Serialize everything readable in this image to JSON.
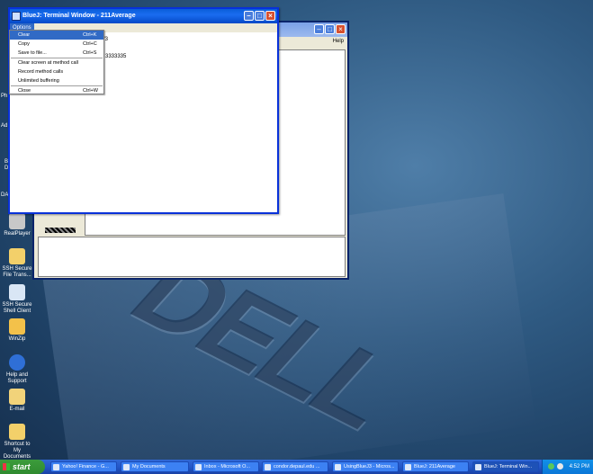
{
  "desktop": {
    "icons": [
      {
        "label": "RealPlayer",
        "color": "#c8c8c8"
      },
      {
        "label": "SSH Secure File Trans...",
        "color": "#f3d06a"
      },
      {
        "label": "SSH Secure Shell Client",
        "color": "#d9e6f5"
      },
      {
        "label": "WinZip",
        "color": "#f3c14a"
      },
      {
        "label": "Help and Support",
        "color": "#2f6fd6"
      },
      {
        "label": "E-mail",
        "color": "#f2d37a"
      },
      {
        "label": "Shortcut to My Documents",
        "color": "#f3d06a"
      }
    ],
    "partial_labels": [
      "Ph",
      "Ad",
      "B",
      "D",
      "DA"
    ]
  },
  "back_window": {
    "help_label": "Help"
  },
  "terminal_window": {
    "title": "BlueJ: Terminal Window - 211Average",
    "menu_label": "Options",
    "text_fragment_1": "/3",
    "text_fragment_2": "3333335",
    "menu_items": [
      {
        "label": "Clear",
        "shortcut": "Ctrl+K",
        "highlighted": true
      },
      {
        "label": "Copy",
        "shortcut": "Ctrl+C"
      },
      {
        "label": "Save to file...",
        "shortcut": "Ctrl+S"
      },
      {
        "label": "Clear screen at method call",
        "shortcut": ""
      },
      {
        "label": "Record method calls",
        "shortcut": ""
      },
      {
        "label": "Unlimited buffering",
        "shortcut": ""
      },
      {
        "label": "Close",
        "shortcut": "Ctrl+W"
      }
    ]
  },
  "taskbar": {
    "start_label": "start",
    "tasks": [
      {
        "label": "Yahoo! Finance - G..."
      },
      {
        "label": "My Documents"
      },
      {
        "label": "Inbox - Microsoft O..."
      },
      {
        "label": "condor.depaul.edu ..."
      },
      {
        "label": "UsingBlueJ3 - Micros..."
      },
      {
        "label": "BlueJ: 211Average"
      },
      {
        "label": "BlueJ: Terminal Win..."
      }
    ],
    "clock": "4:52 PM"
  },
  "colors": {
    "xp_blue": "#0a5ed8",
    "menu_highlight": "#316ac5",
    "start_green": "#2f8a2f"
  }
}
